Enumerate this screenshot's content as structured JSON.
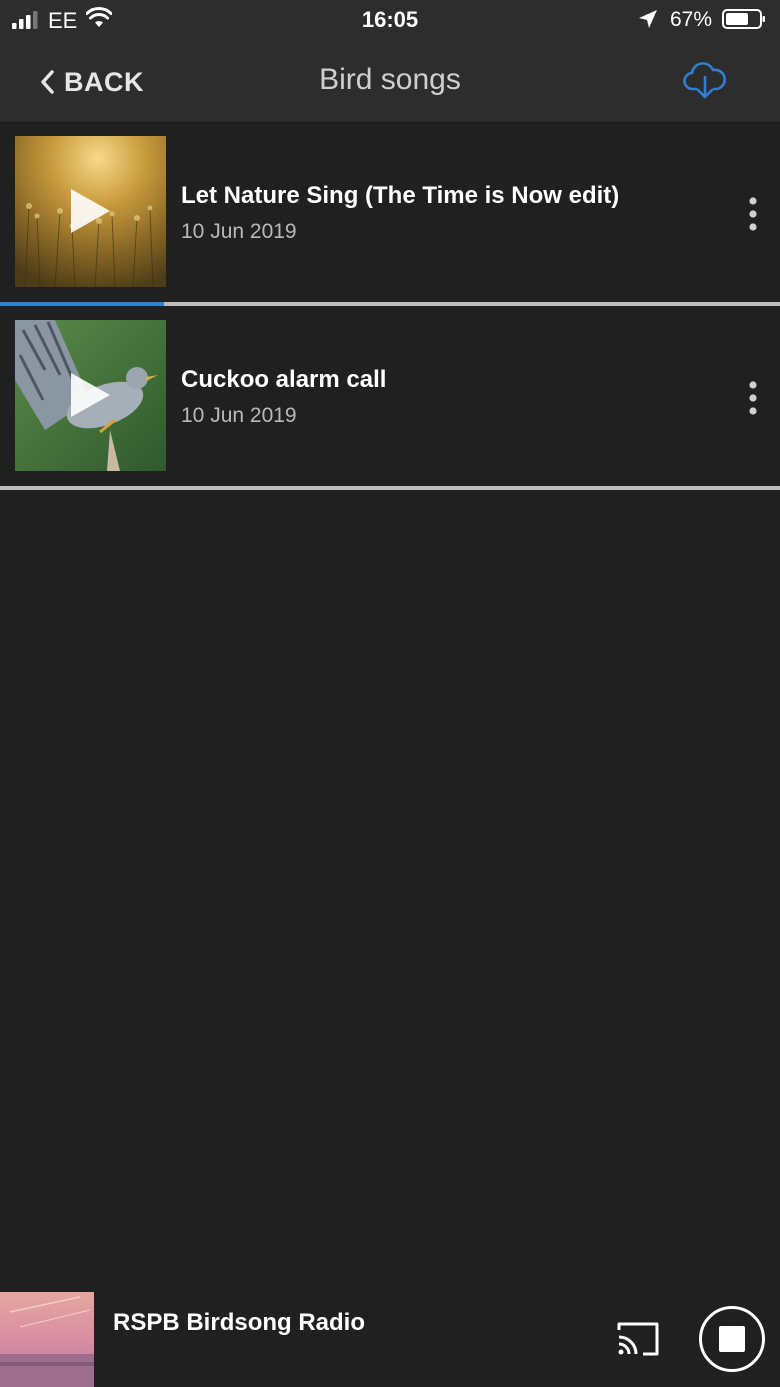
{
  "status_bar": {
    "carrier": "EE",
    "time": "16:05",
    "battery": "67%"
  },
  "nav": {
    "back_label": "BACK",
    "title": "Bird songs"
  },
  "episodes": [
    {
      "title": "Let Nature Sing (The Time is Now edit)",
      "date": "10 Jun 2019",
      "progress": 0.21
    },
    {
      "title": "Cuckoo alarm call",
      "date": "10 Jun 2019",
      "progress": 0
    }
  ],
  "player": {
    "title": "RSPB Birdsong Radio"
  },
  "colors": {
    "accent": "#2f7fd3",
    "background": "#202020",
    "bar": "#2d2d2d"
  }
}
